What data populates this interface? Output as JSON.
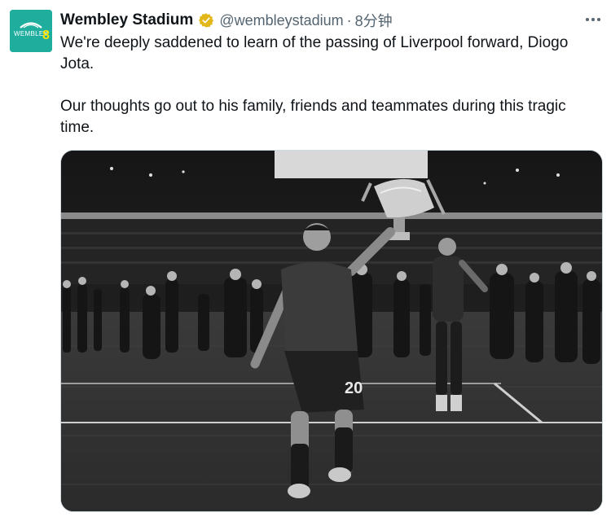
{
  "tweet": {
    "author_name": "Wembley Stadium",
    "handle": "@wembleystadium",
    "separator": "·",
    "time": "8分钟",
    "text_line1": "We're deeply saddened to learn of the passing of Liverpool forward, Diogo Jota.",
    "text_line2": "Our thoughts go out to his family, friends and teammates during this tragic time.",
    "avatar_label": "WEMBLEY",
    "avatar_digit": "8",
    "verified_color": "#e2b719",
    "avatar_color": "#1fae9e"
  },
  "media": {
    "jersey_number": "20",
    "icons": [
      "verified-badge-icon",
      "more-options-icon"
    ]
  }
}
